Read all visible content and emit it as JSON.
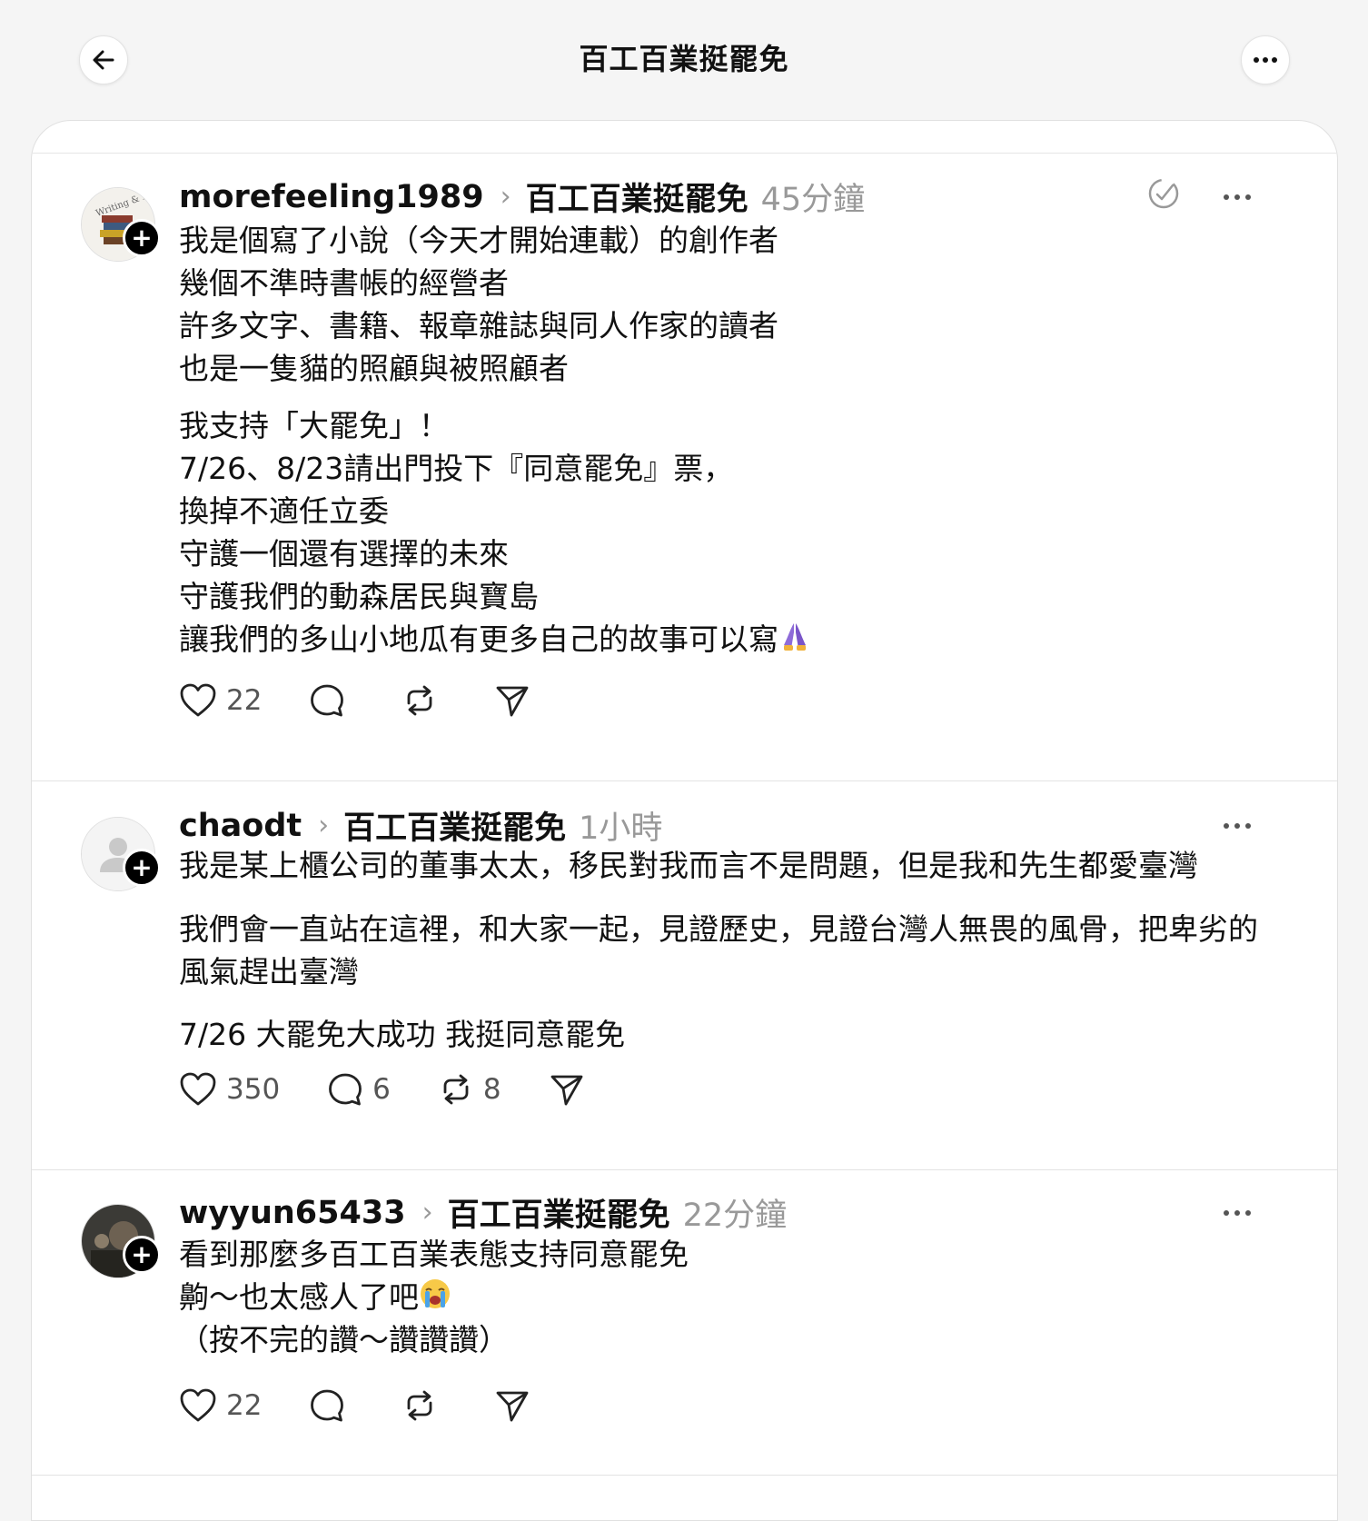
{
  "page": {
    "title": "百工百業挺罷免",
    "back_icon": "arrow-left-icon",
    "more_icon": "more-horizontal-icon"
  },
  "posts": [
    {
      "username": "morefeeling1989",
      "topic": "百工百業挺罷免",
      "time": "45分鐘",
      "paragraphs": [
        "我是個寫了小說（今天才開始連載）的創作者\n幾個不準時書帳的經營者\n許多文字、書籍、報章雜誌與同人作家的讀者\n也是一隻貓的照顧與被照顧者",
        "我支持「大罷免」！\n7/26、8/23請出門投下『同意罷免』票，\n換掉不適任立委\n守護一個還有選擇的未來\n守護我們的動森居民與寶島\n讓我們的多山小地瓜有更多自己的故事可以寫"
      ],
      "trailing_emoji": "🙏",
      "likes": "22",
      "replies": "",
      "reposts": ""
    },
    {
      "username": "chaodt",
      "topic": "百工百業挺罷免",
      "time": "1小時",
      "paragraphs": [
        "我是某上櫃公司的董事太太，移民對我而言不是問題，但是我和先生都愛臺灣",
        "我們會一直站在這裡，和大家一起，見證歷史，見證台灣人無畏的風骨，把卑劣的\n風氣趕出臺灣",
        "7/26 大罷免大成功 我挺同意罷免"
      ],
      "likes": "350",
      "replies": "6",
      "reposts": "8"
    },
    {
      "username": "wyyun65433",
      "topic": "百工百業挺罷免",
      "time": "22分鐘",
      "paragraphs": [
        "看到那麼多百工百業表態支持同意罷免\n齁～也太感人了吧",
        "（按不完的讚～讚讚讚）"
      ],
      "trailing_emoji": "😭",
      "likes": "22",
      "replies": "",
      "reposts": ""
    }
  ],
  "icons": {
    "like": "heart-icon",
    "reply": "comment-bubble-icon",
    "repost": "repost-icon",
    "share": "send-icon",
    "edit": "edit-check-icon",
    "follow": "plus-icon"
  },
  "colors": {
    "background": "#f5f5f5",
    "card": "#ffffff",
    "secondary_text": "#999999"
  }
}
